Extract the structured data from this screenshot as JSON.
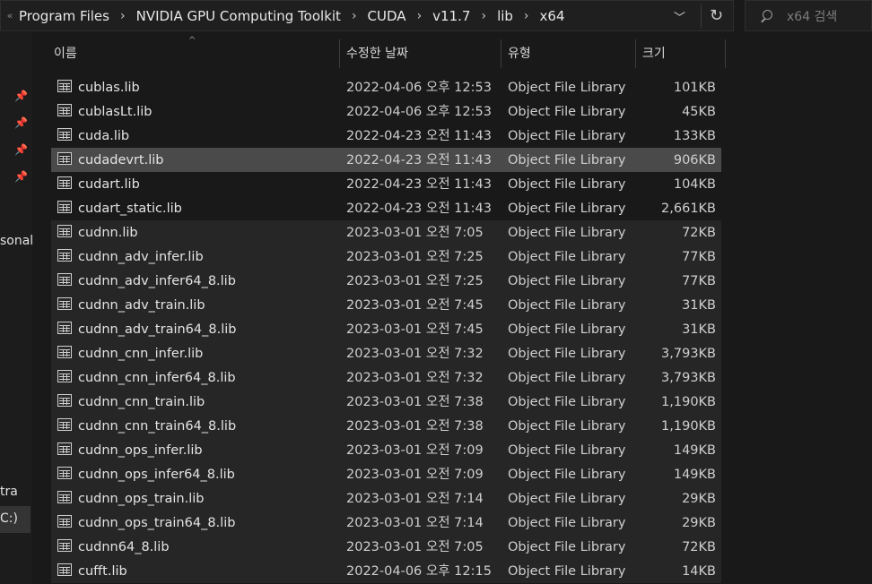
{
  "breadcrumb": {
    "overflow": "«",
    "items": [
      "Program Files",
      "NVIDIA GPU Computing Toolkit",
      "CUDA",
      "v11.7",
      "lib",
      "x64"
    ]
  },
  "search": {
    "placeholder": "x64 검색"
  },
  "nav": {
    "partial_labels": [
      "sonal",
      "tra",
      "C:)"
    ]
  },
  "columns": {
    "name": "이름",
    "date": "수정한 날짜",
    "type": "유형",
    "size": "크기"
  },
  "files": [
    {
      "name": "cublas.lib",
      "date": "2022-04-06 오후 12:53",
      "type": "Object File Library",
      "size": "101KB"
    },
    {
      "name": "cublasLt.lib",
      "date": "2022-04-06 오후 12:53",
      "type": "Object File Library",
      "size": "45KB"
    },
    {
      "name": "cuda.lib",
      "date": "2022-04-23 오전 11:43",
      "type": "Object File Library",
      "size": "133KB"
    },
    {
      "name": "cudadevrt.lib",
      "date": "2022-04-23 오전 11:43",
      "type": "Object File Library",
      "size": "906KB"
    },
    {
      "name": "cudart.lib",
      "date": "2022-04-23 오전 11:43",
      "type": "Object File Library",
      "size": "104KB"
    },
    {
      "name": "cudart_static.lib",
      "date": "2022-04-23 오전 11:43",
      "type": "Object File Library",
      "size": "2,661KB"
    },
    {
      "name": "cudnn.lib",
      "date": "2023-03-01 오전 7:05",
      "type": "Object File Library",
      "size": "72KB"
    },
    {
      "name": "cudnn_adv_infer.lib",
      "date": "2023-03-01 오전 7:25",
      "type": "Object File Library",
      "size": "77KB"
    },
    {
      "name": "cudnn_adv_infer64_8.lib",
      "date": "2023-03-01 오전 7:25",
      "type": "Object File Library",
      "size": "77KB"
    },
    {
      "name": "cudnn_adv_train.lib",
      "date": "2023-03-01 오전 7:45",
      "type": "Object File Library",
      "size": "31KB"
    },
    {
      "name": "cudnn_adv_train64_8.lib",
      "date": "2023-03-01 오전 7:45",
      "type": "Object File Library",
      "size": "31KB"
    },
    {
      "name": "cudnn_cnn_infer.lib",
      "date": "2023-03-01 오전 7:32",
      "type": "Object File Library",
      "size": "3,793KB"
    },
    {
      "name": "cudnn_cnn_infer64_8.lib",
      "date": "2023-03-01 오전 7:32",
      "type": "Object File Library",
      "size": "3,793KB"
    },
    {
      "name": "cudnn_cnn_train.lib",
      "date": "2023-03-01 오전 7:38",
      "type": "Object File Library",
      "size": "1,190KB"
    },
    {
      "name": "cudnn_cnn_train64_8.lib",
      "date": "2023-03-01 오전 7:38",
      "type": "Object File Library",
      "size": "1,190KB"
    },
    {
      "name": "cudnn_ops_infer.lib",
      "date": "2023-03-01 오전 7:09",
      "type": "Object File Library",
      "size": "149KB"
    },
    {
      "name": "cudnn_ops_infer64_8.lib",
      "date": "2023-03-01 오전 7:09",
      "type": "Object File Library",
      "size": "149KB"
    },
    {
      "name": "cudnn_ops_train.lib",
      "date": "2023-03-01 오전 7:14",
      "type": "Object File Library",
      "size": "29KB"
    },
    {
      "name": "cudnn_ops_train64_8.lib",
      "date": "2023-03-01 오전 7:14",
      "type": "Object File Library",
      "size": "29KB"
    },
    {
      "name": "cudnn64_8.lib",
      "date": "2023-03-01 오전 7:05",
      "type": "Object File Library",
      "size": "72KB"
    },
    {
      "name": "cufft.lib",
      "date": "2022-04-06 오후 12:15",
      "type": "Object File Library",
      "size": "14KB"
    }
  ],
  "selected_file": "cudadevrt.lib"
}
